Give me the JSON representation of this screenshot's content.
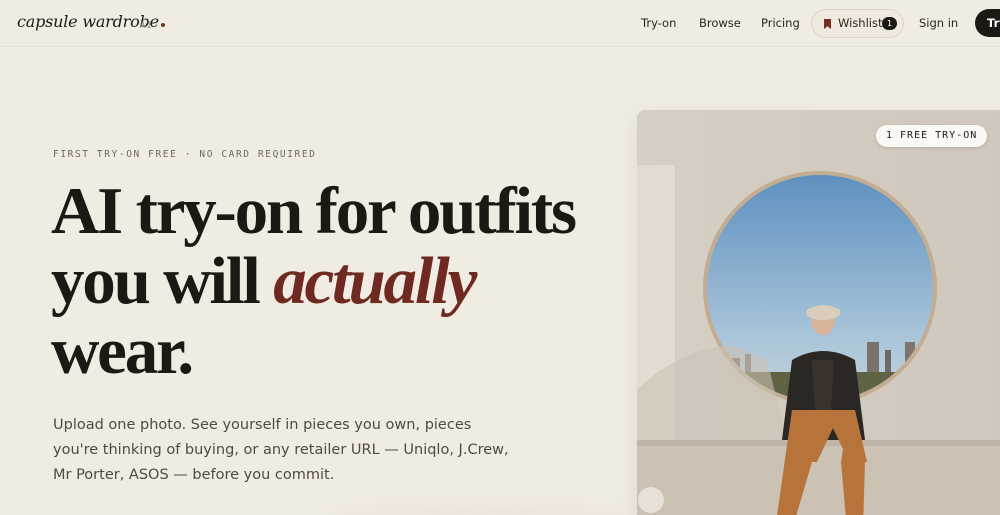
{
  "nav": {
    "logo": "capsule wardrobe",
    "logo_suffix": "AI",
    "links": [
      "Try-on",
      "Browse",
      "Pricing"
    ],
    "wishlist_label": "Wishlist",
    "wishlist_count": "1",
    "signin": "Sign in",
    "cta": "Try"
  },
  "hero": {
    "eyebrow": "FIRST TRY-ON FREE · NO CARD REQUIRED",
    "headline_line1": "AI try-on for outfits",
    "headline_line2_prefix": "you will ",
    "headline_emphasis": "actually",
    "headline_line3": "wear.",
    "subtext": "Upload one photo. See yourself in pieces you own, pieces you're thinking of buying, or any retailer URL — Uniqlo, J.Crew, Mr Porter, ASOS — before you commit."
  },
  "photo": {
    "badge": "1 FREE TRY-ON"
  },
  "colors": {
    "background": "#f1ece2",
    "accent": "#6e2a20",
    "dark": "#1c1915"
  }
}
